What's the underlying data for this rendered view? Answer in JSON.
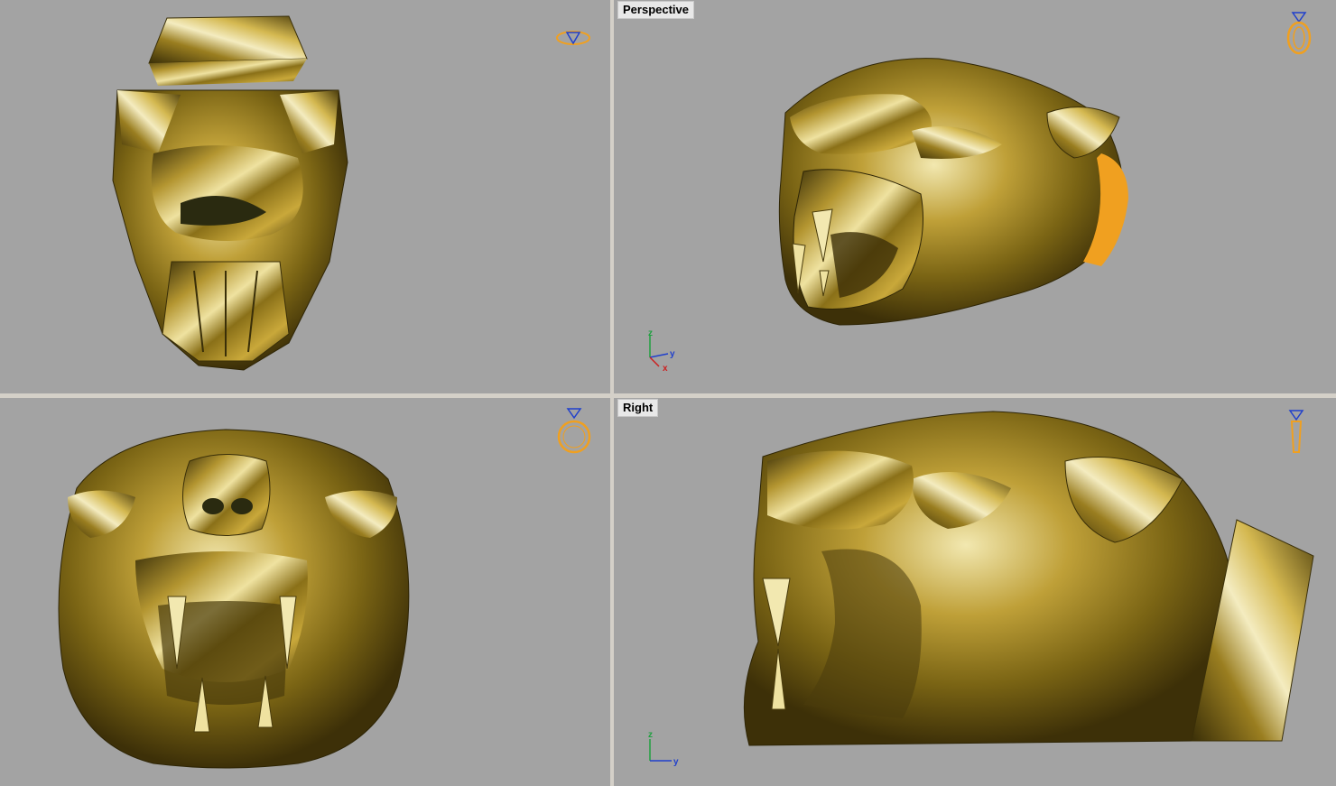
{
  "viewports": {
    "top": {
      "label": "",
      "axes": []
    },
    "perspective": {
      "label": "Perspective",
      "axes": [
        "z",
        "y",
        "x"
      ]
    },
    "front": {
      "label": "",
      "axes": []
    },
    "right": {
      "label": "Right",
      "axes": [
        "z",
        "y"
      ]
    }
  },
  "colors": {
    "viewport_bg": "#a3a3a3",
    "gold_dark": "#5a4a10",
    "gold_mid": "#a88a22",
    "gold_light": "#e8d890",
    "accent_orange": "#f0a020",
    "axis_x": "#cc2020",
    "axis_y": "#2040cc",
    "axis_z": "#20a040"
  },
  "icons": {
    "top": "ring-top-view-icon",
    "perspective": "ring-perspective-icon",
    "front": "ring-front-view-icon",
    "right": "ring-side-view-icon"
  }
}
